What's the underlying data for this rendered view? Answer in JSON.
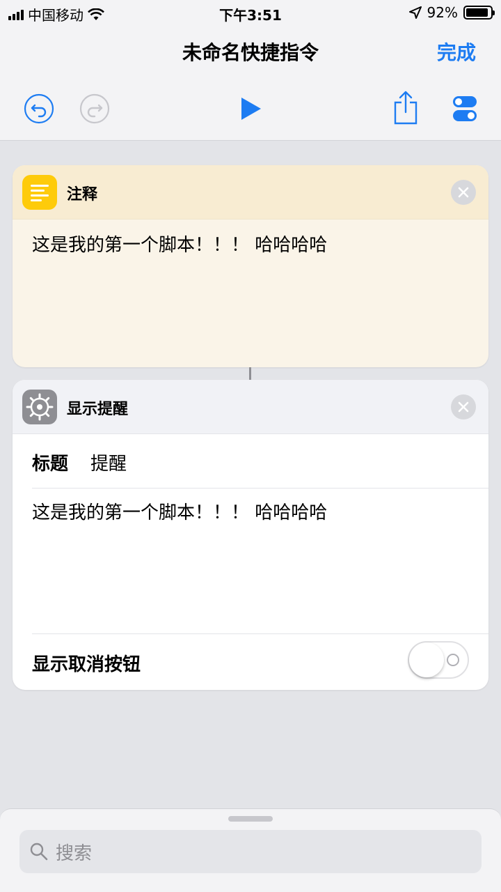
{
  "status_bar": {
    "carrier": "中国移动",
    "time": "下午3:51",
    "battery_percent": "92%",
    "battery_level": 0.92
  },
  "nav": {
    "title": "未命名快捷指令",
    "done_label": "完成"
  },
  "comment_card": {
    "title": "注释",
    "text": "这是我的第一个脚本！！！ 哈哈哈哈",
    "icon": "notes-icon"
  },
  "alert_card": {
    "title": "显示提醒",
    "field_label": "标题",
    "field_value": "提醒",
    "message": "这是我的第一个脚本！！！ 哈哈哈哈",
    "toggle_label": "显示取消按钮",
    "toggle_on": false,
    "icon": "gear-icon"
  },
  "search": {
    "placeholder": "搜索"
  },
  "colors": {
    "accent": "#1d7cf2",
    "comment_icon_bg": "#fecb0b",
    "alert_icon_bg": "#8e8e93"
  }
}
